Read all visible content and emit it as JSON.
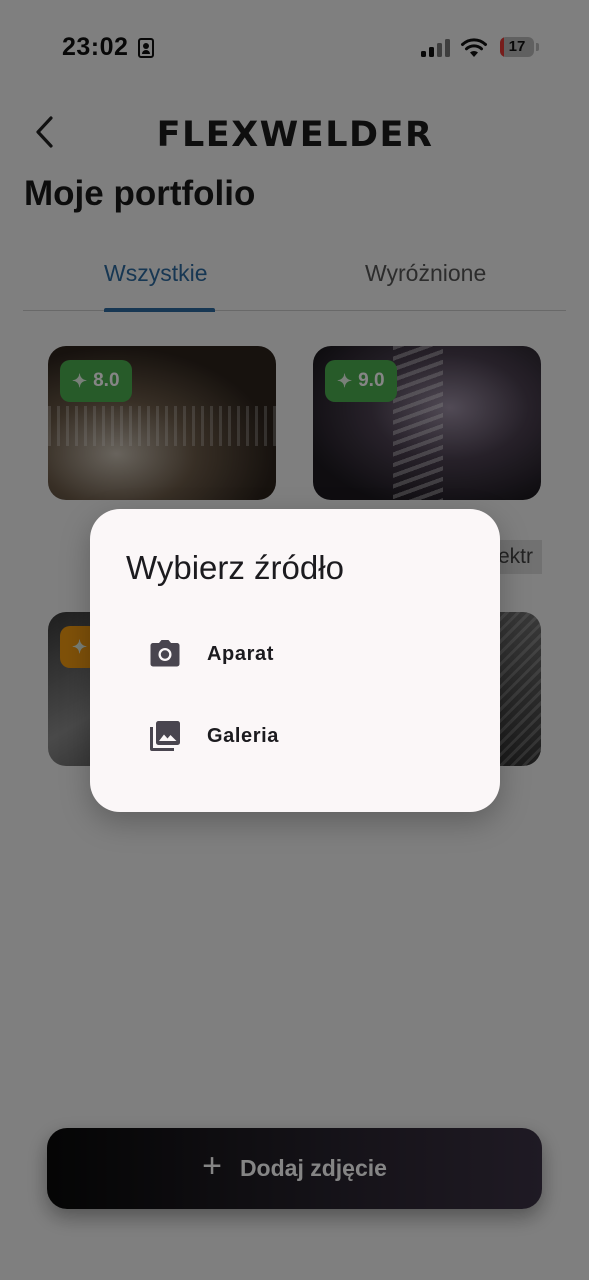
{
  "status_bar": {
    "time": "23:02",
    "battery": "17"
  },
  "header": {
    "logo_text": "FLEXWELDER",
    "title": "Moje portfolio"
  },
  "tabs": [
    {
      "label": "Wszystkie",
      "active": true
    },
    {
      "label": "Wyróżnione",
      "active": false
    }
  ],
  "cards": [
    {
      "score": "8.0",
      "badge_color": "#4caf50"
    },
    {
      "score": "9.0",
      "badge_color": "#4caf50"
    },
    {
      "score": "",
      "badge_color": "#f39c12"
    },
    {
      "score": ""
    }
  ],
  "partial_label": "ektr",
  "add_button": {
    "label": "Dodaj zdjęcie",
    "icon": "plus-icon"
  },
  "dialog": {
    "title": "Wybierz źródło",
    "options": [
      {
        "label": "Aparat",
        "icon": "camera-icon"
      },
      {
        "label": "Galeria",
        "icon": "gallery-icon"
      }
    ]
  },
  "colors": {
    "accent": "#2d6a9f",
    "badge_green": "#4caf50",
    "badge_orange": "#f39c12",
    "dialog_bg": "#fbf7f8",
    "battery_low": "#e53935"
  }
}
